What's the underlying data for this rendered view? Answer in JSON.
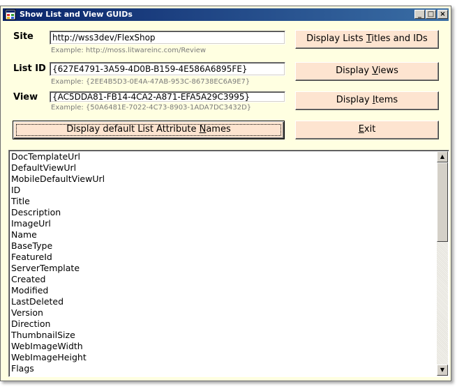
{
  "window": {
    "title": "Show List and View GUIDs",
    "controls": {
      "minimize": "_",
      "maximize": "□",
      "close": "×"
    }
  },
  "form": {
    "site": {
      "label": "Site",
      "value": "http://wss3dev/FlexShop",
      "hint": "Example: http://moss.litwareinc.com/Review"
    },
    "list_id": {
      "label": "List ID",
      "value": "{627E4791-3A59-4D0B-B159-4E586A6895FE}",
      "hint": "Example: {2EE4B5D3-0E4A-47AB-953C-86738EC6A9E7}"
    },
    "view": {
      "label": "View",
      "value": "{AC5DDA81-FB14-4CA2-A871-EFA5A29C3995}",
      "hint": "Example: {50A6481E-7022-4C73-8903-1ADA7DC3432D}"
    }
  },
  "buttons": {
    "display_lists": {
      "pre": "Display Lists ",
      "key": "T",
      "post": "itles and IDs"
    },
    "display_views": {
      "pre": "Display ",
      "key": "V",
      "post": "iews"
    },
    "display_items": {
      "pre": "Display ",
      "key": "I",
      "post": "tems"
    },
    "display_default": {
      "pre": "Display default List Attribute ",
      "key": "N",
      "post": "ames"
    },
    "exit": {
      "pre": "",
      "key": "E",
      "post": "xit"
    }
  },
  "list": {
    "items": [
      "DocTemplateUrl",
      "DefaultViewUrl",
      "MobileDefaultViewUrl",
      "ID",
      "Title",
      "Description",
      "ImageUrl",
      "Name",
      "BaseType",
      "FeatureId",
      "ServerTemplate",
      "Created",
      "Modified",
      "LastDeleted",
      "Version",
      "Direction",
      "ThumbnailSize",
      "WebImageWidth",
      "WebImageHeight",
      "Flags"
    ]
  },
  "icons": {
    "app": "app-window-icon",
    "scroll_up": "scroll-up-arrow-icon",
    "scroll_down": "scroll-down-arrow-icon"
  }
}
